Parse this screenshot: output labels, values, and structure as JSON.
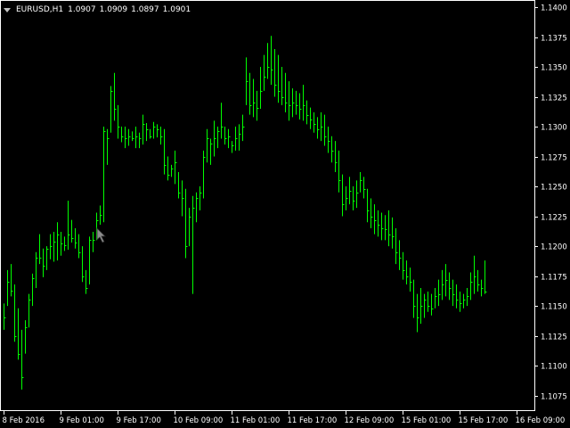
{
  "header": {
    "symbol": "EURUSD,H1",
    "open": "1.0907",
    "high": "1.0909",
    "low": "1.0897",
    "close": "1.0901"
  },
  "colors": {
    "background": "#000000",
    "bars": "#00ff00",
    "frame": "#ffffff",
    "text": "#ffffff"
  },
  "icons": {
    "collapse": "triangle-down-icon",
    "cursor": "mouse-pointer-icon"
  },
  "chart_data": {
    "type": "bar",
    "subtype": "ohlc",
    "symbol": "EURUSD",
    "timeframe": "H1",
    "ylim": [
      1.1062,
      1.1406
    ],
    "y_ticks": [
      "1.1400",
      "1.1375",
      "1.1350",
      "1.1325",
      "1.1300",
      "1.1275",
      "1.1250",
      "1.1225",
      "1.1200",
      "1.1175",
      "1.1150",
      "1.1125",
      "1.1100",
      "1.1075"
    ],
    "x_labels": [
      {
        "label": "8 Feb 2016",
        "bar": 0
      },
      {
        "label": "9 Feb 01:00",
        "bar": 16
      },
      {
        "label": "9 Feb 17:00",
        "bar": 32
      },
      {
        "label": "10 Feb 09:00",
        "bar": 48
      },
      {
        "label": "11 Feb 01:00",
        "bar": 64
      },
      {
        "label": "11 Feb 17:00",
        "bar": 80
      },
      {
        "label": "12 Feb 09:00",
        "bar": 96
      },
      {
        "label": "15 Feb 01:00",
        "bar": 112
      },
      {
        "label": "15 Feb 17:00",
        "bar": 128
      },
      {
        "label": "16 Feb 09:00",
        "bar": 144
      }
    ],
    "grid": false,
    "bars_hlc": [
      [
        1.1152,
        1.113,
        1.114
      ],
      [
        1.118,
        1.115,
        1.117
      ],
      [
        1.1185,
        1.1158,
        1.1163
      ],
      [
        1.1168,
        1.112,
        1.1125
      ],
      [
        1.1148,
        1.1105,
        1.111
      ],
      [
        1.113,
        1.108,
        1.109
      ],
      [
        1.1138,
        1.111,
        1.1132
      ],
      [
        1.116,
        1.1132,
        1.1155
      ],
      [
        1.1177,
        1.115,
        1.1173
      ],
      [
        1.1195,
        1.1165,
        1.119
      ],
      [
        1.121,
        1.1185,
        1.119
      ],
      [
        1.1198,
        1.1174,
        1.1184
      ],
      [
        1.12,
        1.118,
        1.1198
      ],
      [
        1.121,
        1.1189,
        1.12
      ],
      [
        1.1212,
        1.1187,
        1.1204
      ],
      [
        1.122,
        1.1188,
        1.121
      ],
      [
        1.1212,
        1.1192,
        1.1202
      ],
      [
        1.1208,
        1.1196,
        1.1201
      ],
      [
        1.1238,
        1.1197,
        1.121
      ],
      [
        1.1222,
        1.1203,
        1.1207
      ],
      [
        1.1215,
        1.1198,
        1.1203
      ],
      [
        1.121,
        1.119,
        1.1195
      ],
      [
        1.12,
        1.117,
        1.1175
      ],
      [
        1.118,
        1.116,
        1.1165
      ],
      [
        1.1208,
        1.1168,
        1.1205
      ],
      [
        1.1212,
        1.1195,
        1.1205
      ],
      [
        1.1228,
        1.1205,
        1.1222
      ],
      [
        1.1234,
        1.1218,
        1.1226
      ],
      [
        1.13,
        1.122,
        1.1296
      ],
      [
        1.1298,
        1.1268,
        1.129
      ],
      [
        1.1334,
        1.1295,
        1.133
      ],
      [
        1.1345,
        1.1305,
        1.1315
      ],
      [
        1.1318,
        1.129,
        1.13
      ],
      [
        1.13,
        1.1287,
        1.1292
      ],
      [
        1.13,
        1.1282,
        1.129
      ],
      [
        1.1298,
        1.1284,
        1.1292
      ],
      [
        1.1296,
        1.1288,
        1.129
      ],
      [
        1.13,
        1.1282,
        1.1292
      ],
      [
        1.1295,
        1.1282,
        1.129
      ],
      [
        1.131,
        1.1285,
        1.1302
      ],
      [
        1.1303,
        1.1288,
        1.1298
      ],
      [
        1.1298,
        1.129,
        1.1292
      ],
      [
        1.1304,
        1.129,
        1.13
      ],
      [
        1.1302,
        1.1291,
        1.1298
      ],
      [
        1.13,
        1.1285,
        1.1292
      ],
      [
        1.1298,
        1.126,
        1.1268
      ],
      [
        1.1275,
        1.1255,
        1.126
      ],
      [
        1.1268,
        1.1258,
        1.1265
      ],
      [
        1.128,
        1.1252,
        1.127
      ],
      [
        1.1262,
        1.124,
        1.1245
      ],
      [
        1.1255,
        1.1225,
        1.124
      ],
      [
        1.1248,
        1.119,
        1.12
      ],
      [
        1.1232,
        1.12,
        1.1225
      ],
      [
        1.1242,
        1.116,
        1.1232
      ],
      [
        1.1245,
        1.122,
        1.124
      ],
      [
        1.125,
        1.123,
        1.1245
      ],
      [
        1.128,
        1.124,
        1.1275
      ],
      [
        1.1298,
        1.127,
        1.129
      ],
      [
        1.129,
        1.1268,
        1.1286
      ],
      [
        1.1305,
        1.1275,
        1.129
      ],
      [
        1.13,
        1.1282,
        1.1296
      ],
      [
        1.132,
        1.129,
        1.13
      ],
      [
        1.13,
        1.1285,
        1.129
      ],
      [
        1.1298,
        1.1282,
        1.1292
      ],
      [
        1.1288,
        1.1278,
        1.1284
      ],
      [
        1.13,
        1.128,
        1.129
      ],
      [
        1.1302,
        1.128,
        1.1294
      ],
      [
        1.131,
        1.1288,
        1.13
      ],
      [
        1.1358,
        1.1318,
        1.1338
      ],
      [
        1.1345,
        1.131,
        1.1318
      ],
      [
        1.134,
        1.1308,
        1.132
      ],
      [
        1.133,
        1.1305,
        1.1316
      ],
      [
        1.135,
        1.1315,
        1.133
      ],
      [
        1.136,
        1.133,
        1.1342
      ],
      [
        1.137,
        1.134,
        1.135
      ],
      [
        1.1376,
        1.1335,
        1.1348
      ],
      [
        1.1365,
        1.1325,
        1.1335
      ],
      [
        1.136,
        1.132,
        1.133
      ],
      [
        1.135,
        1.1318,
        1.1325
      ],
      [
        1.1345,
        1.1312,
        1.132
      ],
      [
        1.1338,
        1.1305,
        1.1318
      ],
      [
        1.1332,
        1.1308,
        1.132
      ],
      [
        1.133,
        1.131,
        1.1318
      ],
      [
        1.1328,
        1.1306,
        1.1315
      ],
      [
        1.1335,
        1.1305,
        1.1318
      ],
      [
        1.1322,
        1.1302,
        1.131
      ],
      [
        1.1316,
        1.1298,
        1.1306
      ],
      [
        1.1312,
        1.1295,
        1.1302
      ],
      [
        1.1308,
        1.129,
        1.1298
      ],
      [
        1.1312,
        1.1288,
        1.13
      ],
      [
        1.131,
        1.1284,
        1.1292
      ],
      [
        1.13,
        1.1278,
        1.1288
      ],
      [
        1.1292,
        1.127,
        1.128
      ],
      [
        1.1288,
        1.1262,
        1.127
      ],
      [
        1.128,
        1.1245,
        1.1255
      ],
      [
        1.126,
        1.1225,
        1.1235
      ],
      [
        1.125,
        1.123,
        1.124
      ],
      [
        1.1258,
        1.1235,
        1.1246
      ],
      [
        1.125,
        1.123,
        1.1238
      ],
      [
        1.1255,
        1.1232,
        1.1245
      ],
      [
        1.1262,
        1.1245,
        1.1255
      ],
      [
        1.1258,
        1.124,
        1.1248
      ],
      [
        1.1248,
        1.122,
        1.123
      ],
      [
        1.124,
        1.1215,
        1.1225
      ],
      [
        1.1235,
        1.121,
        1.1222
      ],
      [
        1.123,
        1.1208,
        1.1218
      ],
      [
        1.1228,
        1.1205,
        1.1215
      ],
      [
        1.1226,
        1.1205,
        1.1214
      ],
      [
        1.123,
        1.12,
        1.121
      ],
      [
        1.1224,
        1.1198,
        1.1208
      ],
      [
        1.1215,
        1.1185,
        1.1195
      ],
      [
        1.1205,
        1.118,
        1.119
      ],
      [
        1.1195,
        1.1172,
        1.118
      ],
      [
        1.1188,
        1.1168,
        1.1175
      ],
      [
        1.1182,
        1.1162,
        1.117
      ],
      [
        1.1172,
        1.114,
        1.115
      ],
      [
        1.116,
        1.1128,
        1.114
      ],
      [
        1.1165,
        1.1135,
        1.115
      ],
      [
        1.116,
        1.114,
        1.1155
      ],
      [
        1.1162,
        1.1145,
        1.115
      ],
      [
        1.116,
        1.1142,
        1.1148
      ],
      [
        1.1165,
        1.1148,
        1.1158
      ],
      [
        1.1172,
        1.115,
        1.116
      ],
      [
        1.118,
        1.1155,
        1.1168
      ],
      [
        1.1185,
        1.1158,
        1.1172
      ],
      [
        1.1178,
        1.1155,
        1.1165
      ],
      [
        1.1172,
        1.115,
        1.116
      ],
      [
        1.1168,
        1.1148,
        1.1155
      ],
      [
        1.1162,
        1.1145,
        1.1152
      ],
      [
        1.116,
        1.1148,
        1.1155
      ],
      [
        1.1165,
        1.115,
        1.1158
      ],
      [
        1.1178,
        1.1155,
        1.117
      ],
      [
        1.1192,
        1.116,
        1.1175
      ],
      [
        1.118,
        1.1162,
        1.1168
      ],
      [
        1.1172,
        1.1158,
        1.1165
      ],
      [
        1.1188,
        1.116,
        1.1162
      ]
    ]
  }
}
